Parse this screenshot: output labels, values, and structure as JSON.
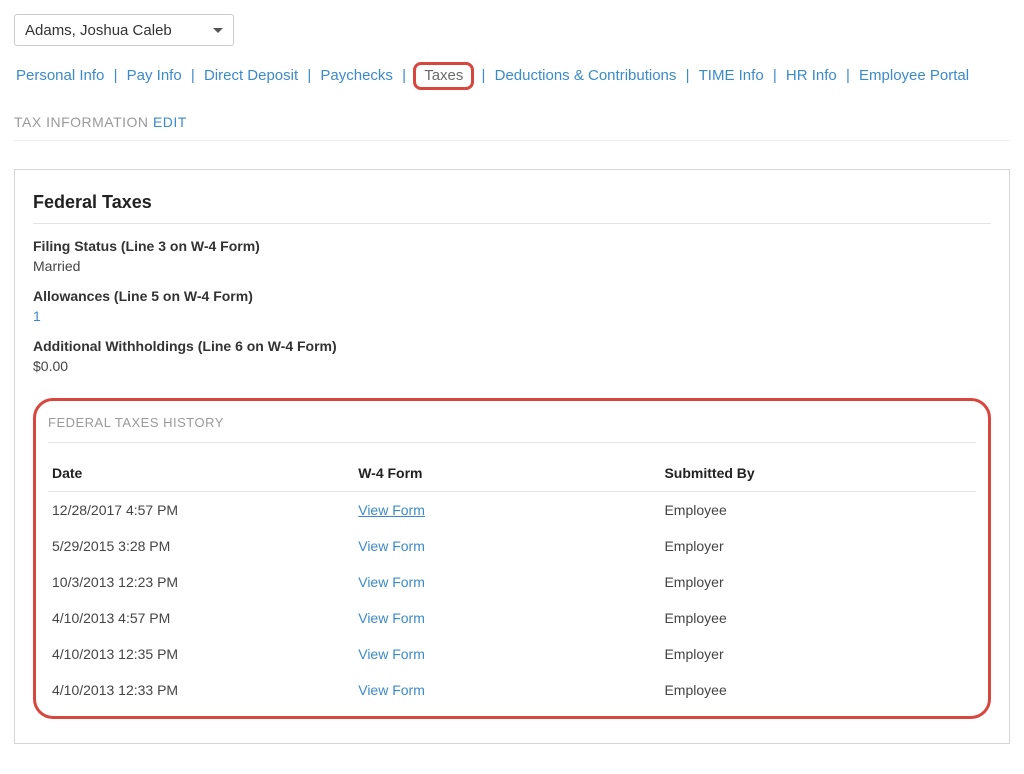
{
  "employee_select": {
    "value": "Adams, Joshua Caleb"
  },
  "nav": {
    "items": [
      "Personal Info",
      "Pay Info",
      "Direct Deposit",
      "Paychecks",
      "Taxes",
      "Deductions & Contributions",
      "TIME Info",
      "HR Info",
      "Employee Portal"
    ],
    "active_index": 4
  },
  "section": {
    "title": "TAX INFORMATION",
    "edit": "EDIT"
  },
  "panel": {
    "title": "Federal Taxes",
    "filing_status": {
      "label": "Filing Status (Line 3 on W-4 Form)",
      "value": "Married"
    },
    "allowances": {
      "label": "Allowances (Line 5 on W-4 Form)",
      "value": "1"
    },
    "additional": {
      "label": "Additional Withholdings (Line 6 on W-4 Form)",
      "value": "$0.00"
    }
  },
  "history": {
    "title": "FEDERAL TAXES HISTORY",
    "columns": {
      "date": "Date",
      "form": "W-4 Form",
      "submitted": "Submitted By"
    },
    "link_label": "View Form",
    "rows": [
      {
        "date": "12/28/2017 4:57 PM",
        "submitted": "Employee",
        "underlined": true
      },
      {
        "date": "5/29/2015 3:28 PM",
        "submitted": "Employer",
        "underlined": false
      },
      {
        "date": "10/3/2013 12:23 PM",
        "submitted": "Employer",
        "underlined": false
      },
      {
        "date": "4/10/2013 4:57 PM",
        "submitted": "Employee",
        "underlined": false
      },
      {
        "date": "4/10/2013 12:35 PM",
        "submitted": "Employer",
        "underlined": false
      },
      {
        "date": "4/10/2013 12:33 PM",
        "submitted": "Employee",
        "underlined": false
      }
    ]
  }
}
